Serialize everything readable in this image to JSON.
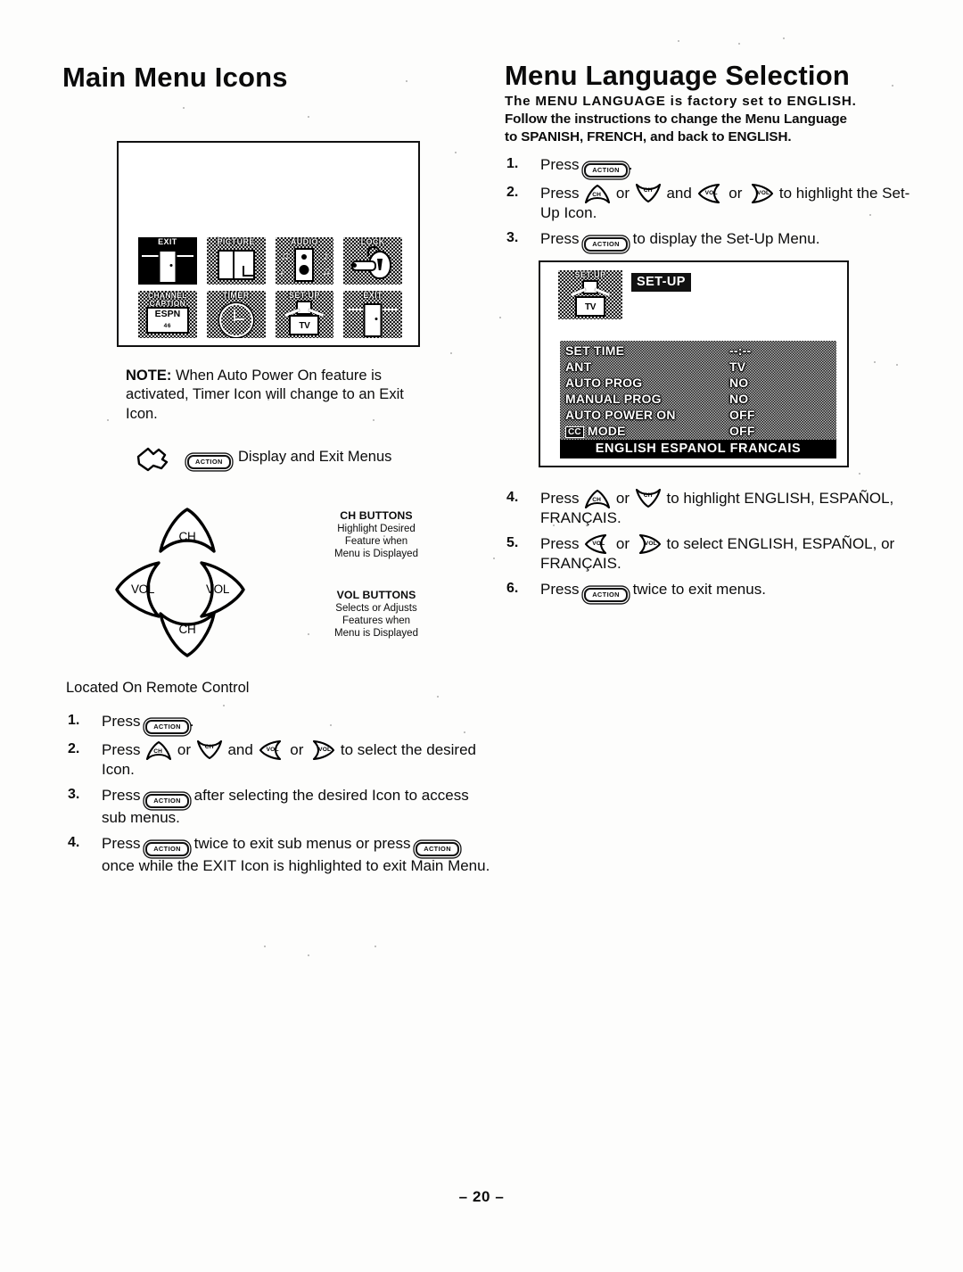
{
  "left": {
    "title": "Main Menu Icons",
    "icon_grid": [
      {
        "caption": "EXIT",
        "art": "exit-door",
        "highlighted": true
      },
      {
        "caption": "PICTURE",
        "art": "picture-frame",
        "highlighted": false
      },
      {
        "caption": "AUDIO",
        "art": "audio-speaker",
        "highlighted": false
      },
      {
        "caption": "LOCK",
        "art": "padlock-key",
        "highlighted": false
      },
      {
        "caption": "CHANNEL CAPTION",
        "art": "channel-caption",
        "screen_text": "ESPN",
        "screen_sub": "46",
        "highlighted": false
      },
      {
        "caption": "TIMER",
        "art": "clock",
        "highlighted": false
      },
      {
        "caption": "SET UP",
        "art": "setup-person-tv",
        "tv_text": "TV",
        "highlighted": false
      },
      {
        "caption": "EXIT",
        "art": "exit-door",
        "highlighted": false
      }
    ],
    "note_label": "NOTE:",
    "note_text": "When Auto Power On feature is activated, Timer Icon will change to an Exit Icon.",
    "hand_action_label": "ACTION",
    "hand_caption": "Display and Exit Menus",
    "ch_buttons": {
      "heading": "CH BUTTONS",
      "lines": [
        "Highlight Desired",
        "Feature when",
        "Menu is Displayed"
      ]
    },
    "vol_buttons": {
      "heading": "VOL BUTTONS",
      "lines": [
        "Selects or Adjusts",
        "Features when",
        "Menu is Displayed"
      ]
    },
    "cluster_keys": {
      "up": "CH",
      "down": "CH",
      "left": "VOL",
      "right": "VOL"
    },
    "located_text": "Located On Remote Control",
    "steps": [
      {
        "num": "1.",
        "parts": [
          {
            "t": "text",
            "v": "Press "
          },
          {
            "t": "action",
            "v": "ACTION"
          },
          {
            "t": "text",
            "v": "."
          }
        ]
      },
      {
        "num": "2.",
        "parts": [
          {
            "t": "text",
            "v": "Press "
          },
          {
            "t": "key",
            "v": "CH",
            "dir": "up"
          },
          {
            "t": "text",
            "v": " or "
          },
          {
            "t": "key",
            "v": "CH",
            "dir": "down"
          },
          {
            "t": "text",
            "v": " and "
          },
          {
            "t": "key",
            "v": "VOL",
            "dir": "left"
          },
          {
            "t": "text",
            "v": " or "
          },
          {
            "t": "key",
            "v": "VOL",
            "dir": "right"
          },
          {
            "t": "text",
            "v": " to select the desired Icon."
          }
        ]
      },
      {
        "num": "3.",
        "parts": [
          {
            "t": "text",
            "v": "Press "
          },
          {
            "t": "action",
            "v": "ACTION"
          },
          {
            "t": "text",
            "v": " after selecting the desired Icon to access sub menus."
          }
        ]
      },
      {
        "num": "4.",
        "parts": [
          {
            "t": "text",
            "v": "Press "
          },
          {
            "t": "action",
            "v": "ACTION"
          },
          {
            "t": "text",
            "v": " twice to exit sub menus or press "
          },
          {
            "t": "action",
            "v": "ACTION"
          },
          {
            "t": "text",
            "v": " once while the EXIT Icon is highlighted to exit Main Menu."
          }
        ]
      }
    ]
  },
  "right": {
    "title": "Menu Language Selection",
    "intro_lines": [
      "The MENU LANGUAGE is factory set to ENGLISH.",
      "Follow the instructions to change the Menu Language",
      "to SPANISH, FRENCH, and back to ENGLISH."
    ],
    "steps_top": [
      {
        "num": "1.",
        "parts": [
          {
            "t": "text",
            "v": "Press "
          },
          {
            "t": "action",
            "v": "ACTION"
          },
          {
            "t": "text",
            "v": "."
          }
        ]
      },
      {
        "num": "2.",
        "parts": [
          {
            "t": "text",
            "v": "Press "
          },
          {
            "t": "key",
            "v": "CH",
            "dir": "up"
          },
          {
            "t": "text",
            "v": " or "
          },
          {
            "t": "key",
            "v": "CH",
            "dir": "down"
          },
          {
            "t": "text",
            "v": " and "
          },
          {
            "t": "key",
            "v": "VOL",
            "dir": "left"
          },
          {
            "t": "text",
            "v": " or "
          },
          {
            "t": "key",
            "v": "VOL",
            "dir": "right"
          },
          {
            "t": "text",
            "v": " to highlight the Set-Up Icon."
          }
        ]
      },
      {
        "num": "3.",
        "parts": [
          {
            "t": "text",
            "v": "Press "
          },
          {
            "t": "action",
            "v": "ACTION"
          },
          {
            "t": "text",
            "v": " to display the Set-Up Menu."
          }
        ]
      }
    ],
    "steps_bottom": [
      {
        "num": "4.",
        "parts": [
          {
            "t": "text",
            "v": "Press "
          },
          {
            "t": "key",
            "v": "CH",
            "dir": "up"
          },
          {
            "t": "text",
            "v": " or "
          },
          {
            "t": "key",
            "v": "CH",
            "dir": "down"
          },
          {
            "t": "text",
            "v": " to highlight ENGLISH, ESPAÑOL, FRANÇAIS."
          }
        ]
      },
      {
        "num": "5.",
        "parts": [
          {
            "t": "text",
            "v": "Press "
          },
          {
            "t": "key",
            "v": "VOL",
            "dir": "left"
          },
          {
            "t": "text",
            "v": " or "
          },
          {
            "t": "key",
            "v": "VOL",
            "dir": "right"
          },
          {
            "t": "text",
            "v": " to select ENGLISH, ESPAÑOL, or FRANÇAIS."
          }
        ]
      },
      {
        "num": "6.",
        "parts": [
          {
            "t": "text",
            "v": "Press "
          },
          {
            "t": "action",
            "v": "ACTION"
          },
          {
            "t": "text",
            "v": " twice to exit menus."
          }
        ]
      }
    ],
    "tv_menu": {
      "icon_caption": "SET UP",
      "icon_tv_text": "TV",
      "title_badge": "SET-UP",
      "rows": [
        {
          "label": "SET TIME",
          "value": "--:--",
          "cc": false
        },
        {
          "label": "ANT",
          "value": "TV",
          "cc": false
        },
        {
          "label": "AUTO PROG",
          "value": "NO",
          "cc": false
        },
        {
          "label": "MANUAL PROG",
          "value": "NO",
          "cc": false
        },
        {
          "label": "AUTO POWER ON",
          "value": "OFF",
          "cc": false
        },
        {
          "label": "MODE",
          "value": "OFF",
          "cc": true,
          "cc_badge": "CC"
        }
      ],
      "language_bar": "ENGLISH  ESPANOL  FRANCAIS"
    }
  },
  "page_number": "– 20 –",
  "colors": {
    "ink": "#0b0b0b",
    "paper": "#fdfdfc",
    "screen_dark": "#1d1d1d"
  }
}
